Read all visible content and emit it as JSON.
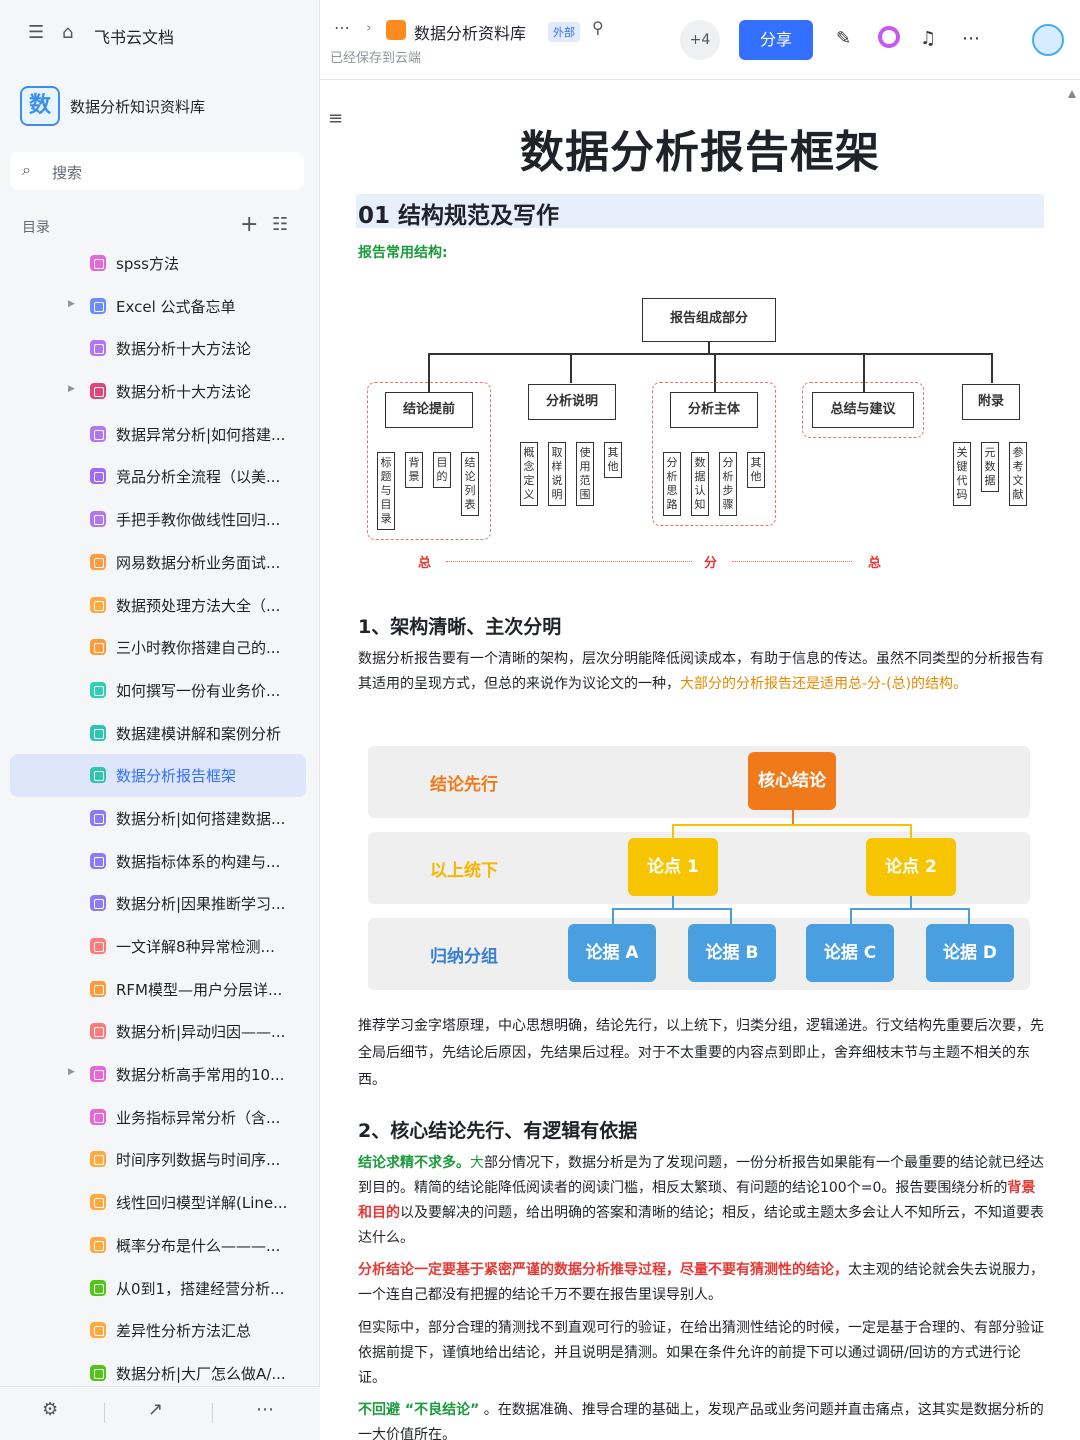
{
  "app": {
    "brand": "飞书云文档"
  },
  "knowledge_base": {
    "logo_char": "数",
    "name": "数据分析知识资料库"
  },
  "search": {
    "placeholder": "搜索"
  },
  "toc": {
    "title": "目录",
    "items": [
      {
        "label": "spss方法",
        "color": "#e667d8",
        "arrow": false
      },
      {
        "label": "Excel 公式备忘单",
        "color": "#6b8cff",
        "arrow": true
      },
      {
        "label": "数据分析十大方法论",
        "color": "#b276f0",
        "arrow": false
      },
      {
        "label": "数据分析十大方法论",
        "color": "#e0457b",
        "arrow": true
      },
      {
        "label": "数据异常分析|如何搭建...",
        "color": "#b276f0",
        "arrow": false
      },
      {
        "label": "竞品分析全流程（以美...",
        "color": "#9d6cf2",
        "arrow": false
      },
      {
        "label": "手把手教你做线性回归...",
        "color": "#b276f0",
        "arrow": false
      },
      {
        "label": "网易数据分析业务面试...",
        "color": "#ff9b3d",
        "arrow": false
      },
      {
        "label": "数据预处理方法大全（...",
        "color": "#ffa940",
        "arrow": false
      },
      {
        "label": "三小时教你搭建自己的...",
        "color": "#ff9b3d",
        "arrow": false
      },
      {
        "label": "如何撰写一份有业务价...",
        "color": "#2ecfb3",
        "arrow": false
      },
      {
        "label": "数据建模讲解和案例分析",
        "color": "#2ec4b6",
        "arrow": false
      },
      {
        "label": "数据分析报告框架",
        "color": "#2ec4b6",
        "arrow": false,
        "active": true
      },
      {
        "label": "数据分析|如何搭建数据...",
        "color": "#8b7cf6",
        "arrow": false
      },
      {
        "label": "数据指标体系的构建与...",
        "color": "#8b7cf6",
        "arrow": false
      },
      {
        "label": "数据分析|因果推断学习...",
        "color": "#8b7cf6",
        "arrow": false
      },
      {
        "label": "一文详解8种异常检测...",
        "color": "#ff7a7a",
        "arrow": false
      },
      {
        "label": "RFM模型—用户分层详...",
        "color": "#ff9b3d",
        "arrow": false
      },
      {
        "label": "数据分析|异动归因——...",
        "color": "#ff7a7a",
        "arrow": false
      },
      {
        "label": "数据分析高手常用的10...",
        "color": "#e667d8",
        "arrow": true
      },
      {
        "label": "业务指标异常分析（含...",
        "color": "#e667d8",
        "arrow": false
      },
      {
        "label": "时间序列数据与时间序...",
        "color": "#ffa940",
        "arrow": false
      },
      {
        "label": "线性回归模型详解(Line...",
        "color": "#ffa940",
        "arrow": false
      },
      {
        "label": "概率分布是什么———...",
        "color": "#ffa940",
        "arrow": false
      },
      {
        "label": "从0到1，搭建经营分析...",
        "color": "#52c41a",
        "arrow": false
      },
      {
        "label": "差异性分析方法汇总",
        "color": "#ffa940",
        "arrow": false
      },
      {
        "label": "数据分析|大厂怎么做A/...",
        "color": "#52c41a",
        "arrow": false
      }
    ]
  },
  "header": {
    "doc_title": "数据分析资料库",
    "badge": "外部",
    "saved": "已经保存到云端",
    "collaborators": "+4",
    "share": "分享"
  },
  "document": {
    "title": "数据分析报告框架",
    "h1": "01 结构规范及写作",
    "green_label": "报告常用结构:",
    "diagram1": {
      "root": "报告组成部分",
      "groups": [
        {
          "title": "结论提前",
          "items": [
            "标题与目录",
            "背景",
            "目的",
            "结论列表"
          ],
          "dashed": true
        },
        {
          "title": "分析说明",
          "items": [
            "概念定义",
            "取样说明",
            "使用范围",
            "其他"
          ],
          "dashed": false
        },
        {
          "title": "分析主体",
          "items": [
            "分析思路",
            "数据认知",
            "分析步骤",
            "其他"
          ],
          "dashed": true
        },
        {
          "title": "总结与建议",
          "items": [],
          "dashed": true
        },
        {
          "title": "附录",
          "items": [
            "关键代码",
            "元数据",
            "参考文献"
          ],
          "dashed": false
        }
      ],
      "bottom": [
        "总",
        "分",
        "总"
      ]
    },
    "s1_title": "1、架构清晰、主次分明",
    "s1_p1_a": "数据分析报告要有一个清晰的架构，层次分明能降低阅读成本，有助于信息的传达。虽然不同类型的分析报告有其适用的呈现方式，但总的来说作为议论文的一种，",
    "s1_p1_b": "大部分的分析报告还是适用总-分-(总)的结构。",
    "diagram2": {
      "rows": [
        "结论先行",
        "以上统下",
        "归纳分组"
      ],
      "core": "核心结论",
      "points": [
        "论点 1",
        "论点 2"
      ],
      "evidence": [
        "论据 A",
        "论据 B",
        "论据 C",
        "论据 D"
      ]
    },
    "s1_p2": "推荐学习金字塔原理，中心思想明确，结论先行，以上统下，归类分组，逻辑递进。行文结构先重要后次要，先全局后细节，先结论后原因，先结果后过程。对于不太重要的内容点到即止，舍弃细枝末节与主题不相关的东西。",
    "s2_title": "2、核心结论先行、有逻辑有依据",
    "s2_p1_a": "结论求精不求多。",
    "s2_p1_b": "大",
    "s2_p1_c": "部分情况下，数据分析是为了发现问题，一份分析报告如果能有一个最重要的结论就已经达到目的。精简的结论能降低阅读者的阅读门槛，相反太繁琐、有问题的结论100个=0。报告要围绕分析的",
    "s2_p1_d": "背景和目的",
    "s2_p1_e": "以及要解决的问题，给出明确的答案和清晰的结论；相反，结论或主题太多会让人不知所云，不知道要表达什么。",
    "s2_p2_a": "分析结论一定要基于紧密严谨的数据分析推导过程，尽量不要有猜测性的结论，",
    "s2_p2_b": "太主观的结论就会失去说服力，一个连自己都没有把握的结论千万不要在报告里误导别人。",
    "s2_p3": "但实际中，部分合理的猜测找不到直观可行的验证，在给出猜测性结论的时候，一定是基于合理的、有部分验证依据前提下，谨慎地给出结论，并且说明是猜测。如果在条件允许的前提下可以通过调研/回访的方式进行论证。",
    "s2_p4_a": "不回避 “不良结论”",
    "s2_p4_b": " 。在数据准确、推导合理的基础上，发现产品或业务问题并直击痛点，这其实是数据分析的一大价值所在。"
  },
  "colors": {
    "accent": "#3370ff",
    "green": "#1b9b3e",
    "red": "#e53935",
    "orange": "#e68a00",
    "core": "#f07a1a",
    "point": "#f7c400",
    "evidence": "#4a9fe0"
  }
}
